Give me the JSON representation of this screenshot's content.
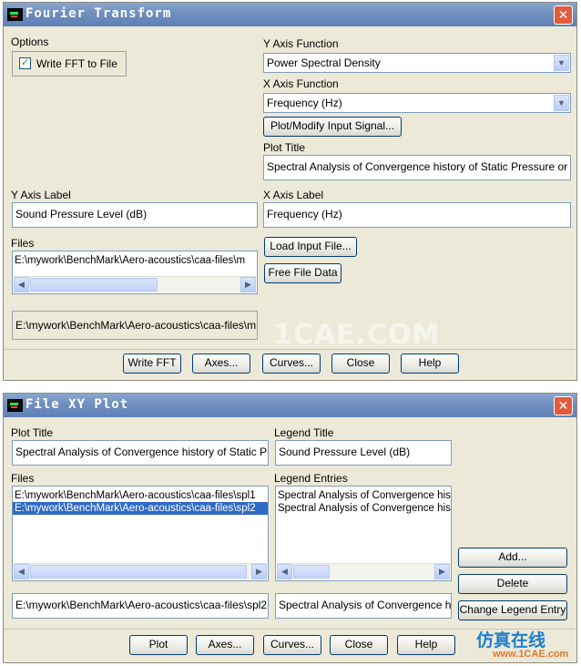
{
  "fourier": {
    "title": "Fourier Transform",
    "options_label": "Options",
    "write_fft_checkbox": {
      "label": "Write FFT to File",
      "checked": true
    },
    "y_axis_function_label": "Y Axis Function",
    "y_axis_function_value": "Power Spectral Density",
    "x_axis_function_label": "X Axis Function",
    "x_axis_function_value": "Frequency (Hz)",
    "plot_modify_button": "Plot/Modify Input Signal...",
    "plot_title_label": "Plot Title",
    "plot_title_value": "Spectral Analysis of Convergence history of Static Pressure or",
    "y_axis_label_label": "Y Axis Label",
    "y_axis_label_value": "Sound Pressure Level (dB)",
    "x_axis_label_label": "X Axis Label",
    "x_axis_label_value": "Frequency (Hz)",
    "files_label": "Files",
    "files_list": [
      "E:\\mywork\\BenchMark\\Aero-acoustics\\caa-files\\m"
    ],
    "selected_file": "E:\\mywork\\BenchMark\\Aero-acoustics\\caa-files\\m",
    "load_input_button": "Load Input File...",
    "free_file_button": "Free File Data",
    "buttons": {
      "write_fft": "Write FFT",
      "axes": "Axes...",
      "curves": "Curves...",
      "close": "Close",
      "help": "Help"
    }
  },
  "xyplot": {
    "title": "File XY Plot",
    "plot_title_label": "Plot Title",
    "plot_title_value": "Spectral Analysis of Convergence history of Static Pr",
    "legend_title_label": "Legend Title",
    "legend_title_value": "Sound Pressure Level (dB)",
    "files_label": "Files",
    "files": [
      "E:\\mywork\\BenchMark\\Aero-acoustics\\caa-files\\spl1",
      "E:\\mywork\\BenchMark\\Aero-acoustics\\caa-files\\spl2"
    ],
    "legend_entries_label": "Legend Entries",
    "legend_entries": [
      "Spectral Analysis of Convergence his",
      "Spectral Analysis of Convergence his"
    ],
    "selected_file": "E:\\mywork\\BenchMark\\Aero-acoustics\\caa-files\\spl2",
    "selected_legend": "Spectral Analysis of Convergence his",
    "add_button": "Add...",
    "delete_button": "Delete",
    "change_legend_button": "Change Legend Entry",
    "buttons": {
      "plot": "Plot",
      "axes": "Axes...",
      "curves": "Curves...",
      "close": "Close",
      "help": "Help"
    }
  },
  "colors": {
    "titlebar": "#6e8fbf",
    "dialog_bg": "#ece9d8",
    "selection": "#316ac5",
    "close_button": "#e35a3c"
  },
  "watermark": {
    "main": "1CAE.COM",
    "brand_cn": "仿真在线",
    "url": "www.1CAE.com"
  }
}
